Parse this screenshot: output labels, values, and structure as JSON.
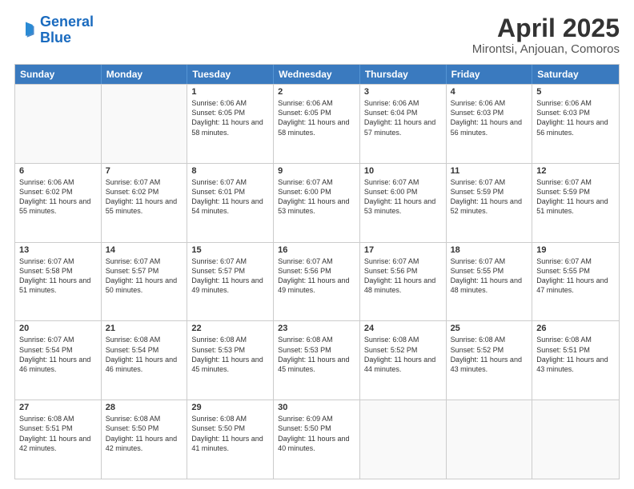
{
  "logo": {
    "line1": "General",
    "line2": "Blue"
  },
  "title": "April 2025",
  "subtitle": "Mirontsi, Anjouan, Comoros",
  "header_days": [
    "Sunday",
    "Monday",
    "Tuesday",
    "Wednesday",
    "Thursday",
    "Friday",
    "Saturday"
  ],
  "weeks": [
    [
      {
        "day": "",
        "text": ""
      },
      {
        "day": "",
        "text": ""
      },
      {
        "day": "1",
        "text": "Sunrise: 6:06 AM\nSunset: 6:05 PM\nDaylight: 11 hours and 58 minutes."
      },
      {
        "day": "2",
        "text": "Sunrise: 6:06 AM\nSunset: 6:05 PM\nDaylight: 11 hours and 58 minutes."
      },
      {
        "day": "3",
        "text": "Sunrise: 6:06 AM\nSunset: 6:04 PM\nDaylight: 11 hours and 57 minutes."
      },
      {
        "day": "4",
        "text": "Sunrise: 6:06 AM\nSunset: 6:03 PM\nDaylight: 11 hours and 56 minutes."
      },
      {
        "day": "5",
        "text": "Sunrise: 6:06 AM\nSunset: 6:03 PM\nDaylight: 11 hours and 56 minutes."
      }
    ],
    [
      {
        "day": "6",
        "text": "Sunrise: 6:06 AM\nSunset: 6:02 PM\nDaylight: 11 hours and 55 minutes."
      },
      {
        "day": "7",
        "text": "Sunrise: 6:07 AM\nSunset: 6:02 PM\nDaylight: 11 hours and 55 minutes."
      },
      {
        "day": "8",
        "text": "Sunrise: 6:07 AM\nSunset: 6:01 PM\nDaylight: 11 hours and 54 minutes."
      },
      {
        "day": "9",
        "text": "Sunrise: 6:07 AM\nSunset: 6:00 PM\nDaylight: 11 hours and 53 minutes."
      },
      {
        "day": "10",
        "text": "Sunrise: 6:07 AM\nSunset: 6:00 PM\nDaylight: 11 hours and 53 minutes."
      },
      {
        "day": "11",
        "text": "Sunrise: 6:07 AM\nSunset: 5:59 PM\nDaylight: 11 hours and 52 minutes."
      },
      {
        "day": "12",
        "text": "Sunrise: 6:07 AM\nSunset: 5:59 PM\nDaylight: 11 hours and 51 minutes."
      }
    ],
    [
      {
        "day": "13",
        "text": "Sunrise: 6:07 AM\nSunset: 5:58 PM\nDaylight: 11 hours and 51 minutes."
      },
      {
        "day": "14",
        "text": "Sunrise: 6:07 AM\nSunset: 5:57 PM\nDaylight: 11 hours and 50 minutes."
      },
      {
        "day": "15",
        "text": "Sunrise: 6:07 AM\nSunset: 5:57 PM\nDaylight: 11 hours and 49 minutes."
      },
      {
        "day": "16",
        "text": "Sunrise: 6:07 AM\nSunset: 5:56 PM\nDaylight: 11 hours and 49 minutes."
      },
      {
        "day": "17",
        "text": "Sunrise: 6:07 AM\nSunset: 5:56 PM\nDaylight: 11 hours and 48 minutes."
      },
      {
        "day": "18",
        "text": "Sunrise: 6:07 AM\nSunset: 5:55 PM\nDaylight: 11 hours and 48 minutes."
      },
      {
        "day": "19",
        "text": "Sunrise: 6:07 AM\nSunset: 5:55 PM\nDaylight: 11 hours and 47 minutes."
      }
    ],
    [
      {
        "day": "20",
        "text": "Sunrise: 6:07 AM\nSunset: 5:54 PM\nDaylight: 11 hours and 46 minutes."
      },
      {
        "day": "21",
        "text": "Sunrise: 6:08 AM\nSunset: 5:54 PM\nDaylight: 11 hours and 46 minutes."
      },
      {
        "day": "22",
        "text": "Sunrise: 6:08 AM\nSunset: 5:53 PM\nDaylight: 11 hours and 45 minutes."
      },
      {
        "day": "23",
        "text": "Sunrise: 6:08 AM\nSunset: 5:53 PM\nDaylight: 11 hours and 45 minutes."
      },
      {
        "day": "24",
        "text": "Sunrise: 6:08 AM\nSunset: 5:52 PM\nDaylight: 11 hours and 44 minutes."
      },
      {
        "day": "25",
        "text": "Sunrise: 6:08 AM\nSunset: 5:52 PM\nDaylight: 11 hours and 43 minutes."
      },
      {
        "day": "26",
        "text": "Sunrise: 6:08 AM\nSunset: 5:51 PM\nDaylight: 11 hours and 43 minutes."
      }
    ],
    [
      {
        "day": "27",
        "text": "Sunrise: 6:08 AM\nSunset: 5:51 PM\nDaylight: 11 hours and 42 minutes."
      },
      {
        "day": "28",
        "text": "Sunrise: 6:08 AM\nSunset: 5:50 PM\nDaylight: 11 hours and 42 minutes."
      },
      {
        "day": "29",
        "text": "Sunrise: 6:08 AM\nSunset: 5:50 PM\nDaylight: 11 hours and 41 minutes."
      },
      {
        "day": "30",
        "text": "Sunrise: 6:09 AM\nSunset: 5:50 PM\nDaylight: 11 hours and 40 minutes."
      },
      {
        "day": "",
        "text": ""
      },
      {
        "day": "",
        "text": ""
      },
      {
        "day": "",
        "text": ""
      }
    ]
  ]
}
